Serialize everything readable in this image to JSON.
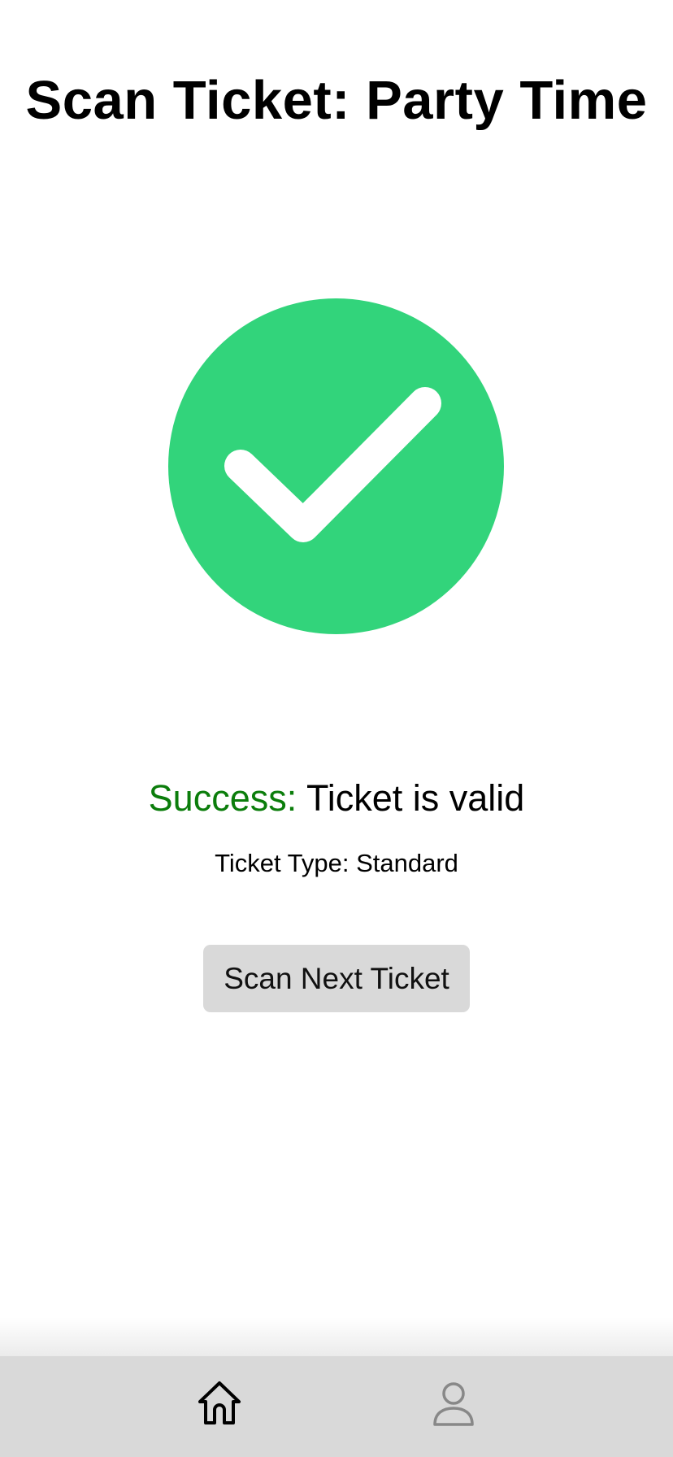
{
  "header": {
    "title": "Scan Ticket: Party Time"
  },
  "result": {
    "icon": "check-circle-icon",
    "icon_color": "#32d47b",
    "status_prefix": "Success:",
    "status_prefix_color": "#0b7d0b",
    "status_message": "Ticket is valid",
    "ticket_type_label": "Ticket Type: Standard"
  },
  "actions": {
    "scan_next_label": "Scan Next Ticket"
  },
  "bottom_nav": {
    "items": [
      {
        "icon": "home-icon",
        "active": true
      },
      {
        "icon": "user-icon",
        "active": false
      }
    ]
  }
}
